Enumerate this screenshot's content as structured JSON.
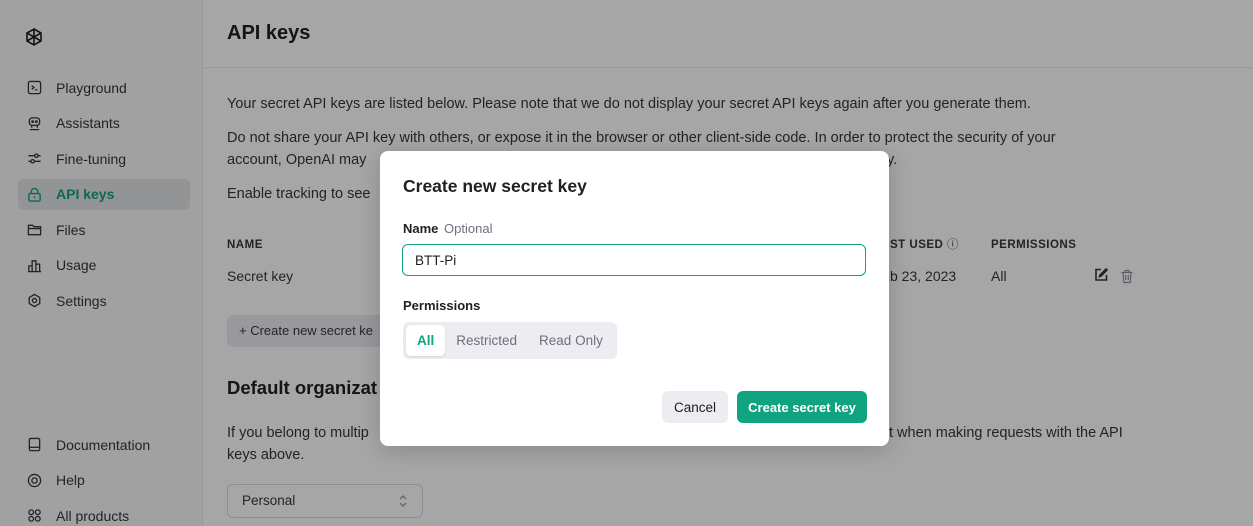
{
  "sidebar": {
    "items": [
      {
        "label": "Playground",
        "icon": "terminal-icon"
      },
      {
        "label": "Assistants",
        "icon": "robot-icon"
      },
      {
        "label": "Fine-tuning",
        "icon": "tune-icon"
      },
      {
        "label": "API keys",
        "icon": "lock-icon"
      },
      {
        "label": "Files",
        "icon": "folder-icon"
      },
      {
        "label": "Usage",
        "icon": "bar-chart-icon"
      },
      {
        "label": "Settings",
        "icon": "gear-icon"
      }
    ],
    "bottom_items": [
      {
        "label": "Documentation",
        "icon": "doc-icon"
      },
      {
        "label": "Help",
        "icon": "help-icon"
      },
      {
        "label": "All products",
        "icon": "grid-icon"
      }
    ],
    "active_item": "API keys"
  },
  "main": {
    "title": "API keys",
    "para1": "Your secret API keys are listed below. Please note that we do not display your secret API keys again after you generate them.",
    "para2_line1": "Do not share your API key with others, or expose it in the browser or other client-side code. In order to protect the security of your",
    "para2_line2_start": "account, OpenAI may",
    "para2_line2_end": "y.",
    "para3_start": "Enable tracking to see",
    "table": {
      "col_name": "NAME",
      "col_last_used": "ST USED",
      "col_permissions": "PERMISSIONS",
      "row_name": "Secret key",
      "row_last_used": "b 23, 2023",
      "row_permissions": "All"
    },
    "create_button": "+ Create new secret ke",
    "section_title": "Default organizat",
    "section_text_start": "If you belong to multip",
    "section_text_end": "t when making requests with the API",
    "section_text_line2": "keys above.",
    "org_select": "Personal"
  },
  "modal": {
    "title": "Create new secret key",
    "name_label": "Name",
    "name_optional": "Optional",
    "name_value": "BTT-Pi",
    "permissions_label": "Permissions",
    "permission_options": [
      "All",
      "Restricted",
      "Read Only"
    ],
    "selected_permission": "All",
    "cancel_label": "Cancel",
    "create_label": "Create secret key"
  },
  "colors": {
    "accent": "#10a37f",
    "overlay": "rgba(0,0,0,0.35)"
  }
}
